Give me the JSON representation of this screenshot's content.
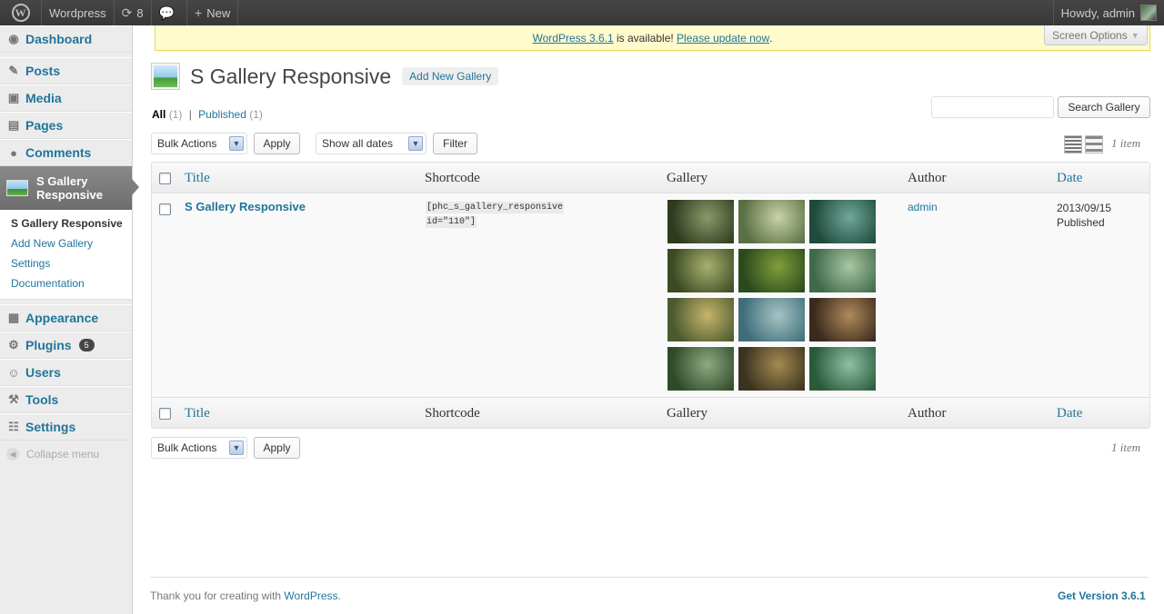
{
  "adminbar": {
    "site_name": "Wordpress",
    "updates_count": "8",
    "new_label": "New",
    "howdy": "Howdy, admin"
  },
  "sidebar": {
    "items_top": [
      {
        "label": "Dashboard",
        "icon": "dashboard-icon"
      }
    ],
    "items_mid": [
      {
        "label": "Posts",
        "icon": "pin-icon"
      },
      {
        "label": "Media",
        "icon": "media-icon"
      },
      {
        "label": "Pages",
        "icon": "pages-icon"
      },
      {
        "label": "Comments",
        "icon": "comment-icon"
      }
    ],
    "current": {
      "label_line1": "S Gallery",
      "label_line2": "Responsive"
    },
    "submenu": [
      "S Gallery Responsive",
      "Add New Gallery",
      "Settings",
      "Documentation"
    ],
    "items_bottom": [
      {
        "label": "Appearance",
        "icon": "appearance-icon"
      },
      {
        "label": "Plugins",
        "icon": "plugins-icon",
        "badge": "5"
      },
      {
        "label": "Users",
        "icon": "users-icon"
      },
      {
        "label": "Tools",
        "icon": "tools-icon"
      },
      {
        "label": "Settings",
        "icon": "settings-icon"
      }
    ],
    "collapse_label": "Collapse menu"
  },
  "nag": {
    "link1": "WordPress 3.6.1",
    "middle": " is available! ",
    "link2": "Please update now",
    "end": "."
  },
  "screen_options": "Screen Options",
  "page": {
    "title": "S Gallery Responsive",
    "add_new": "Add New Gallery"
  },
  "views": {
    "all_label": "All",
    "all_count": "(1)",
    "sep": "|",
    "published_label": "Published",
    "published_count": "(1)"
  },
  "search": {
    "placeholder": "",
    "button": "Search Gallery"
  },
  "tablenav_top": {
    "bulk_actions": "Bulk Actions",
    "apply": "Apply",
    "dates": "Show all dates",
    "filter": "Filter",
    "item_count": "1 item"
  },
  "tablenav_bottom": {
    "bulk_actions": "Bulk Actions",
    "apply": "Apply",
    "item_count": "1 item"
  },
  "table": {
    "columns": {
      "title": "Title",
      "shortcode": "Shortcode",
      "gallery": "Gallery",
      "author": "Author",
      "date": "Date"
    },
    "rows": [
      {
        "title": "S Gallery Responsive",
        "shortcode_line1": "[phc_s_gallery_responsive",
        "shortcode_line2": "id=\"110\"]",
        "author": "admin",
        "date": "2013/09/15",
        "status": "Published"
      }
    ],
    "thumb_colors": [
      [
        "#2d3b1e",
        "#8a9a6a"
      ],
      [
        "#5a7044",
        "#c9d2a8"
      ],
      [
        "#1f4a3c",
        "#6fa89a"
      ],
      [
        "#3b4a22",
        "#a8b070"
      ],
      [
        "#2a4a1c",
        "#7f9e3a"
      ],
      [
        "#3f6a4a",
        "#a9c7a2"
      ],
      [
        "#4a5a2e",
        "#c8b46a"
      ],
      [
        "#3f6e7a",
        "#a7c4c4"
      ],
      [
        "#3a2a1e",
        "#b08a5a"
      ],
      [
        "#2e4a28",
        "#8cab82"
      ],
      [
        "#3a3320",
        "#a48a50"
      ],
      [
        "#2a5a3a",
        "#8fc0a8"
      ]
    ]
  },
  "footer": {
    "text": "Thank you for creating with ",
    "link": "WordPress",
    "end": ".",
    "version": "Get Version 3.6.1"
  }
}
